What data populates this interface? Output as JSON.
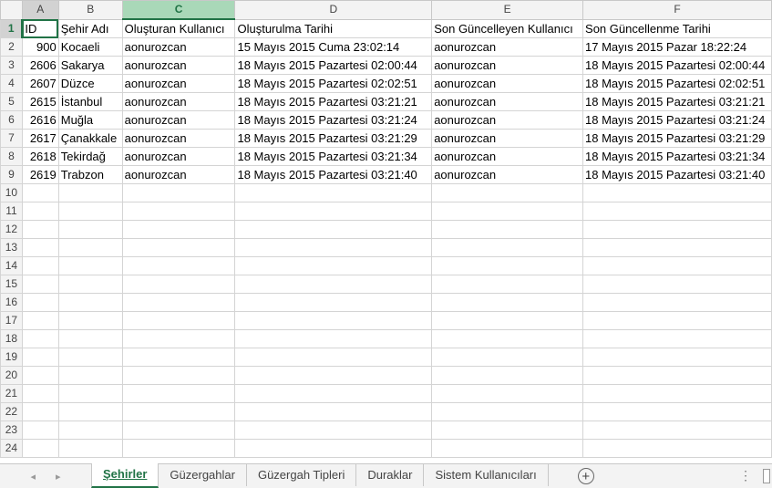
{
  "columns": [
    "A",
    "B",
    "C",
    "D",
    "E",
    "F"
  ],
  "headers": {
    "id": "ID",
    "city": "Şehir Adı",
    "creator": "Oluşturan Kullanıcı",
    "created": "Oluşturulma Tarihi",
    "updater": "Son Güncelleyen Kullanıcı",
    "updated": "Son Güncellenme Tarihi"
  },
  "rows": [
    {
      "id": "900",
      "city": "Kocaeli",
      "creator": "aonurozcan",
      "created": "15 Mayıs 2015 Cuma 23:02:14",
      "updater": "aonurozcan",
      "updated": "17 Mayıs 2015 Pazar 18:22:24"
    },
    {
      "id": "2606",
      "city": "Sakarya",
      "creator": "aonurozcan",
      "created": "18 Mayıs 2015 Pazartesi 02:00:44",
      "updater": "aonurozcan",
      "updated": "18 Mayıs 2015 Pazartesi 02:00:44"
    },
    {
      "id": "2607",
      "city": "Düzce",
      "creator": "aonurozcan",
      "created": "18 Mayıs 2015 Pazartesi 02:02:51",
      "updater": "aonurozcan",
      "updated": "18 Mayıs 2015 Pazartesi 02:02:51"
    },
    {
      "id": "2615",
      "city": "İstanbul",
      "creator": "aonurozcan",
      "created": "18 Mayıs 2015 Pazartesi 03:21:21",
      "updater": "aonurozcan",
      "updated": "18 Mayıs 2015 Pazartesi 03:21:21"
    },
    {
      "id": "2616",
      "city": "Muğla",
      "creator": "aonurozcan",
      "created": "18 Mayıs 2015 Pazartesi 03:21:24",
      "updater": "aonurozcan",
      "updated": "18 Mayıs 2015 Pazartesi 03:21:24"
    },
    {
      "id": "2617",
      "city": "Çanakkale",
      "creator": "aonurozcan",
      "created": "18 Mayıs 2015 Pazartesi 03:21:29",
      "updater": "aonurozcan",
      "updated": "18 Mayıs 2015 Pazartesi 03:21:29"
    },
    {
      "id": "2618",
      "city": "Tekirdağ",
      "creator": "aonurozcan",
      "created": "18 Mayıs 2015 Pazartesi 03:21:34",
      "updater": "aonurozcan",
      "updated": "18 Mayıs 2015 Pazartesi 03:21:34"
    },
    {
      "id": "2619",
      "city": "Trabzon",
      "creator": "aonurozcan",
      "created": "18 Mayıs 2015 Pazartesi 03:21:40",
      "updater": "aonurozcan",
      "updated": "18 Mayıs 2015 Pazartesi 03:21:40"
    }
  ],
  "row_numbers": [
    "1",
    "2",
    "3",
    "4",
    "5",
    "6",
    "7",
    "8",
    "9",
    "10",
    "11",
    "12",
    "13",
    "14",
    "15",
    "16",
    "17",
    "18",
    "19",
    "20",
    "21",
    "22",
    "23",
    "24"
  ],
  "tabs": [
    "Şehirler",
    "Güzergahlar",
    "Güzergah Tipleri",
    "Duraklar",
    "Sistem Kullanıcıları"
  ],
  "active_tab": "Şehirler",
  "icons": {
    "prev": "◂",
    "next": "▸",
    "add": "+",
    "more": "⋮"
  },
  "colors": {
    "accent": "#217346",
    "selected_header": "#a9d8b8"
  }
}
